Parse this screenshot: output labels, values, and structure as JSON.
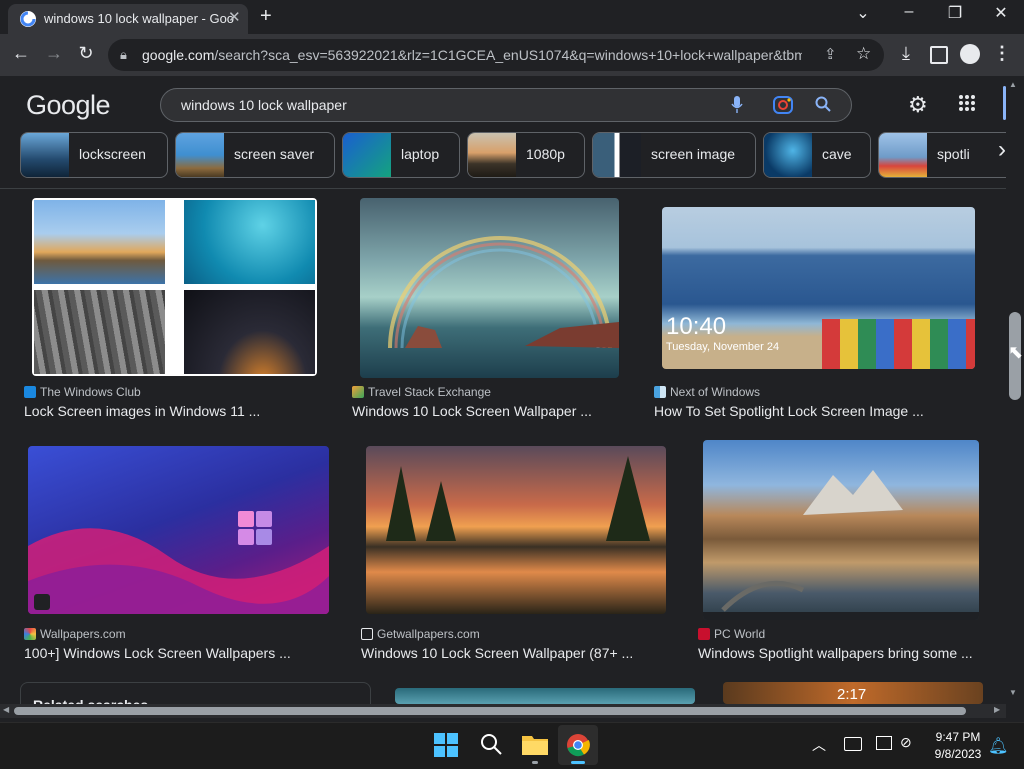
{
  "browser": {
    "tab_title": "windows 10 lock wallpaper - Goo",
    "url_domain": "google.com",
    "url_rest": "/search?sca_esv=563922021&rlz=1C1GCEA_enUS1074&q=windows+10+lock+wallpaper&tbm..."
  },
  "google": {
    "logo": "Google",
    "query": "windows 10 lock wallpaper",
    "chips": [
      {
        "label": "lockscreen"
      },
      {
        "label": "screen saver"
      },
      {
        "label": "laptop"
      },
      {
        "label": "1080p"
      },
      {
        "label": "screen image"
      },
      {
        "label": "cave"
      },
      {
        "label": "spotli"
      }
    ]
  },
  "results": [
    {
      "source": "The Windows Club",
      "title": "Lock Screen images in Windows 11 ..."
    },
    {
      "source": "Travel Stack Exchange",
      "title": "Windows 10 Lock Screen Wallpaper ..."
    },
    {
      "source": "Next of Windows",
      "title": "How To Set Spotlight Lock Screen Image ..."
    },
    {
      "source": "Wallpapers.com",
      "title": "100+] Windows Lock Screen Wallpapers ..."
    },
    {
      "source": "Getwallpapers.com",
      "title": "Windows 10 Lock Screen Wallpaper (87+ ..."
    },
    {
      "source": "PC World",
      "title": "Windows Spotlight wallpapers bring some ..."
    }
  ],
  "overlay_text": {
    "lock_time": "10:40",
    "lock_date": "Tuesday, November 24",
    "partial_time": "2:17",
    "related_partial": "Related searches"
  },
  "taskbar": {
    "time": "9:47 PM",
    "date": "9/8/2023"
  },
  "colors": {
    "page_bg": "#202124",
    "toolbar_bg": "#35363a",
    "accent_blue": "#8ab4f8"
  }
}
